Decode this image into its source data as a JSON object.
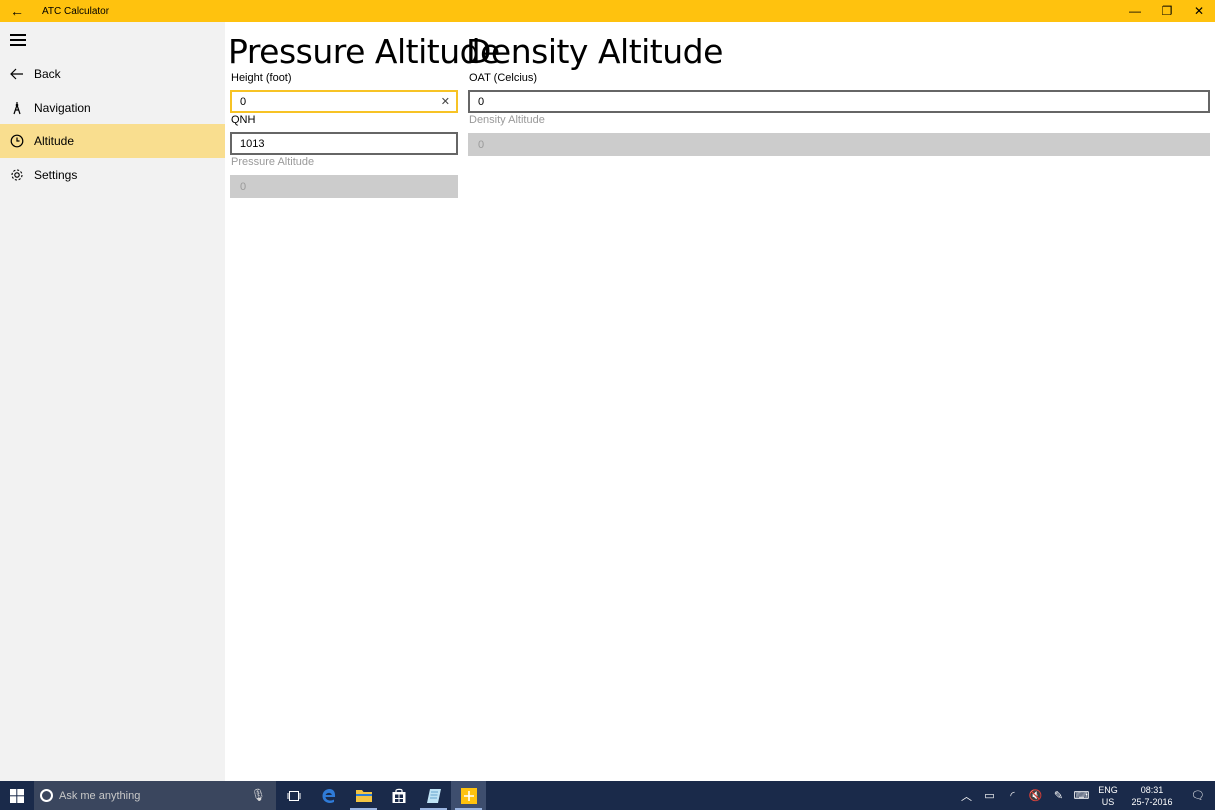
{
  "window": {
    "title": "ATC Calculator",
    "back_glyph": "←",
    "minimize_glyph": "—",
    "maximize_glyph": "❐",
    "close_glyph": "✕"
  },
  "sidebar": {
    "items": [
      {
        "label": "Back",
        "icon": "back-arrow-icon"
      },
      {
        "label": "Navigation",
        "icon": "compass-icon"
      },
      {
        "label": "Altitude",
        "icon": "clock-icon"
      },
      {
        "label": "Settings",
        "icon": "gear-icon"
      }
    ],
    "active_item": "Altitude",
    "active_color": "#F9DE8F"
  },
  "main": {
    "pressure": {
      "title": "Pressure Altitude",
      "height_label": "Height (foot)",
      "height_value": "0",
      "qnh_label": "QNH",
      "qnh_value": "1013",
      "result_label": "Pressure Altitude",
      "result_value": "0"
    },
    "density": {
      "title": "Density Altitude",
      "oat_label": "OAT (Celcius)",
      "oat_value": "0",
      "result_label": "Density Altitude",
      "result_value": "0"
    }
  },
  "taskbar": {
    "search_placeholder": "Ask me anything",
    "language_line1": "ENG",
    "language_line2": "US",
    "time": "08:31",
    "date": "25-7-2016"
  },
  "colors": {
    "accent": "#FFC20E",
    "taskbar": "#1A2A4A",
    "sidebar": "#F2F2F2"
  }
}
